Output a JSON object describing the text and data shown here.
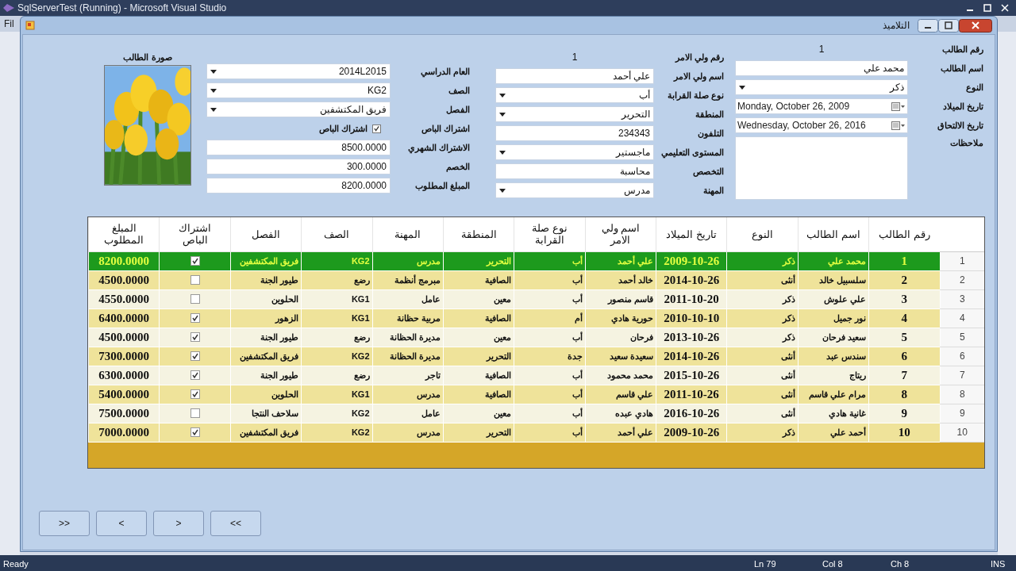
{
  "vs_window": {
    "title": "SqlServerTest (Running) - Microsoft Visual Studio",
    "menu_fragment": "Fil",
    "status_bar": {
      "message": "Ready",
      "line": "Ln 79",
      "column": "Col 8",
      "char": "Ch 8",
      "mode": "INS"
    }
  },
  "form": {
    "title": "التلاميذ"
  },
  "student_fields": [
    {
      "label": "رقم الطالب",
      "kind": "readonly",
      "value": "1"
    },
    {
      "label": "اسم الطالب",
      "kind": "text",
      "value": "محمد علي"
    },
    {
      "label": "النوع",
      "kind": "combo",
      "value": "ذكر"
    },
    {
      "label": "تاريخ الميلاد",
      "kind": "date",
      "value": "Monday, October 26, 2009"
    },
    {
      "label": "تاريخ الالتحاق",
      "kind": "date",
      "value": "Wednesday, October 26, 2016"
    },
    {
      "label": "ملاحظات",
      "kind": "textarea"
    }
  ],
  "guardian_fields": [
    {
      "label": "رقم ولي الامر",
      "kind": "readonly",
      "value": "1"
    },
    {
      "label": "اسم ولي الامر",
      "kind": "text",
      "value": "علي أحمد"
    },
    {
      "label": "نوع صلة القرابة",
      "kind": "combo",
      "value": "أب"
    },
    {
      "label": "المنطقة",
      "kind": "combo",
      "value": "التحرير"
    },
    {
      "label": "التلفون",
      "kind": "text",
      "value": "234343"
    },
    {
      "label": "المستوى التعليمي",
      "kind": "combo",
      "value": "ماجستير"
    },
    {
      "label": "التخصص",
      "kind": "text",
      "value": "محاسبة"
    },
    {
      "label": "المهنة",
      "kind": "combo",
      "value": "مدرس"
    }
  ],
  "enrollment_fields": [
    {
      "label": "العام الدراسي",
      "kind": "combo",
      "value": "2014L2015"
    },
    {
      "label": "الصف",
      "kind": "combo",
      "value": "KG2"
    },
    {
      "label": "الفصل",
      "kind": "combo",
      "value": "فريق المكتشفين"
    },
    {
      "label": "اشتراك الباص",
      "kind": "check",
      "value": "اشتراك الباص",
      "checked": true
    },
    {
      "label": "الاشتراك الشهري",
      "kind": "text",
      "value": "8500.0000"
    },
    {
      "label": "الخصم",
      "kind": "text",
      "value": "300.0000"
    },
    {
      "label": "المبلغ المطلوب",
      "kind": "text",
      "value": "8200.0000"
    }
  ],
  "photo": {
    "label": "صورة الطالب",
    "kind": "picture"
  },
  "grid": {
    "columns": [
      {
        "title": "رقم الطالب",
        "kind": "number"
      },
      {
        "title": "اسم الطالب",
        "kind": "text"
      },
      {
        "title": "النوع",
        "kind": "text"
      },
      {
        "title": "تاريخ الميلاد",
        "kind": "number"
      },
      {
        "title": "اسم ولي الامر",
        "kind": "text"
      },
      {
        "title": "نوع صلة القرابة",
        "kind": "text"
      },
      {
        "title": "المنطقة",
        "kind": "text"
      },
      {
        "title": "المهنة",
        "kind": "text"
      },
      {
        "title": "الصف",
        "kind": "text"
      },
      {
        "title": "الفصل",
        "kind": "text"
      },
      {
        "title": "اشتراك الباص",
        "kind": "check"
      },
      {
        "title": "المبلغ المطلوب",
        "kind": "number"
      }
    ],
    "rows": [
      {
        "header": "1",
        "selected": true,
        "bus_subscription": true,
        "cells": [
          "1",
          "محمد علي",
          "ذكر",
          "2009-10-26",
          "علي أحمد",
          "أب",
          "التحرير",
          "مدرس",
          "KG2",
          "فريق المكتشفين",
          "8200.0000"
        ]
      },
      {
        "header": "2",
        "selected": false,
        "bus_subscription": false,
        "cells": [
          "2",
          "سلسبيل خالد",
          "أنثى",
          "2014-10-26",
          "خالد أحمد",
          "أب",
          "الصافية",
          "مبرمج أنظمة",
          "رضع",
          "طيور الجنة",
          "4500.0000"
        ]
      },
      {
        "header": "3",
        "selected": false,
        "bus_subscription": false,
        "cells": [
          "3",
          "علي علوش",
          "ذكر",
          "2011-10-20",
          "قاسم منصور",
          "أب",
          "معين",
          "عامل",
          "KG1",
          "الحلوين",
          "4550.0000"
        ]
      },
      {
        "header": "4",
        "selected": false,
        "bus_subscription": true,
        "cells": [
          "4",
          "نور جميل",
          "ذكر",
          "2010-10-10",
          "حورية هادي",
          "أم",
          "الصافية",
          "مربية حظانة",
          "KG1",
          "الزهور",
          "6400.0000"
        ]
      },
      {
        "header": "5",
        "selected": false,
        "bus_subscription": true,
        "cells": [
          "5",
          "سعيد فرحان",
          "ذكر",
          "2013-10-26",
          "فرحان",
          "أب",
          "معين",
          "مديرة الحظانة",
          "رضع",
          "طيور الجنة",
          "4500.0000"
        ]
      },
      {
        "header": "6",
        "selected": false,
        "bus_subscription": true,
        "cells": [
          "6",
          "سندس عبد",
          "أنثى",
          "2014-10-26",
          "سعيدة سعيد",
          "جدة",
          "التحرير",
          "مديرة الحظانة",
          "KG2",
          "فريق المكتشفين",
          "7300.0000"
        ]
      },
      {
        "header": "7",
        "selected": false,
        "bus_subscription": true,
        "cells": [
          "7",
          "ريتاج",
          "أنثى",
          "2015-10-26",
          "محمد محمود",
          "أب",
          "الصافية",
          "تاجر",
          "رضع",
          "طيور الجنة",
          "6300.0000"
        ]
      },
      {
        "header": "8",
        "selected": false,
        "bus_subscription": true,
        "cells": [
          "8",
          "مرام علي قاسم",
          "أنثى",
          "2011-10-26",
          "علي قاسم",
          "أب",
          "الصافية",
          "مدرس",
          "KG1",
          "الحلوين",
          "5400.0000"
        ]
      },
      {
        "header": "9",
        "selected": false,
        "bus_subscription": false,
        "cells": [
          "9",
          "غانية هادي",
          "أنثى",
          "2016-10-26",
          "هادي عبده",
          "أب",
          "معين",
          "عامل",
          "KG2",
          "سلاحف النتجا",
          "7500.0000"
        ]
      },
      {
        "header": "10",
        "selected": false,
        "bus_subscription": true,
        "cells": [
          "10",
          "أحمد علي",
          "ذكر",
          "2009-10-26",
          "علي أحمد",
          "أب",
          "التحرير",
          "مدرس",
          "KG2",
          "فريق المكتشفين",
          "7000.0000"
        ]
      }
    ]
  },
  "nav_buttons": [
    "<<",
    ">",
    "<",
    ">>"
  ]
}
